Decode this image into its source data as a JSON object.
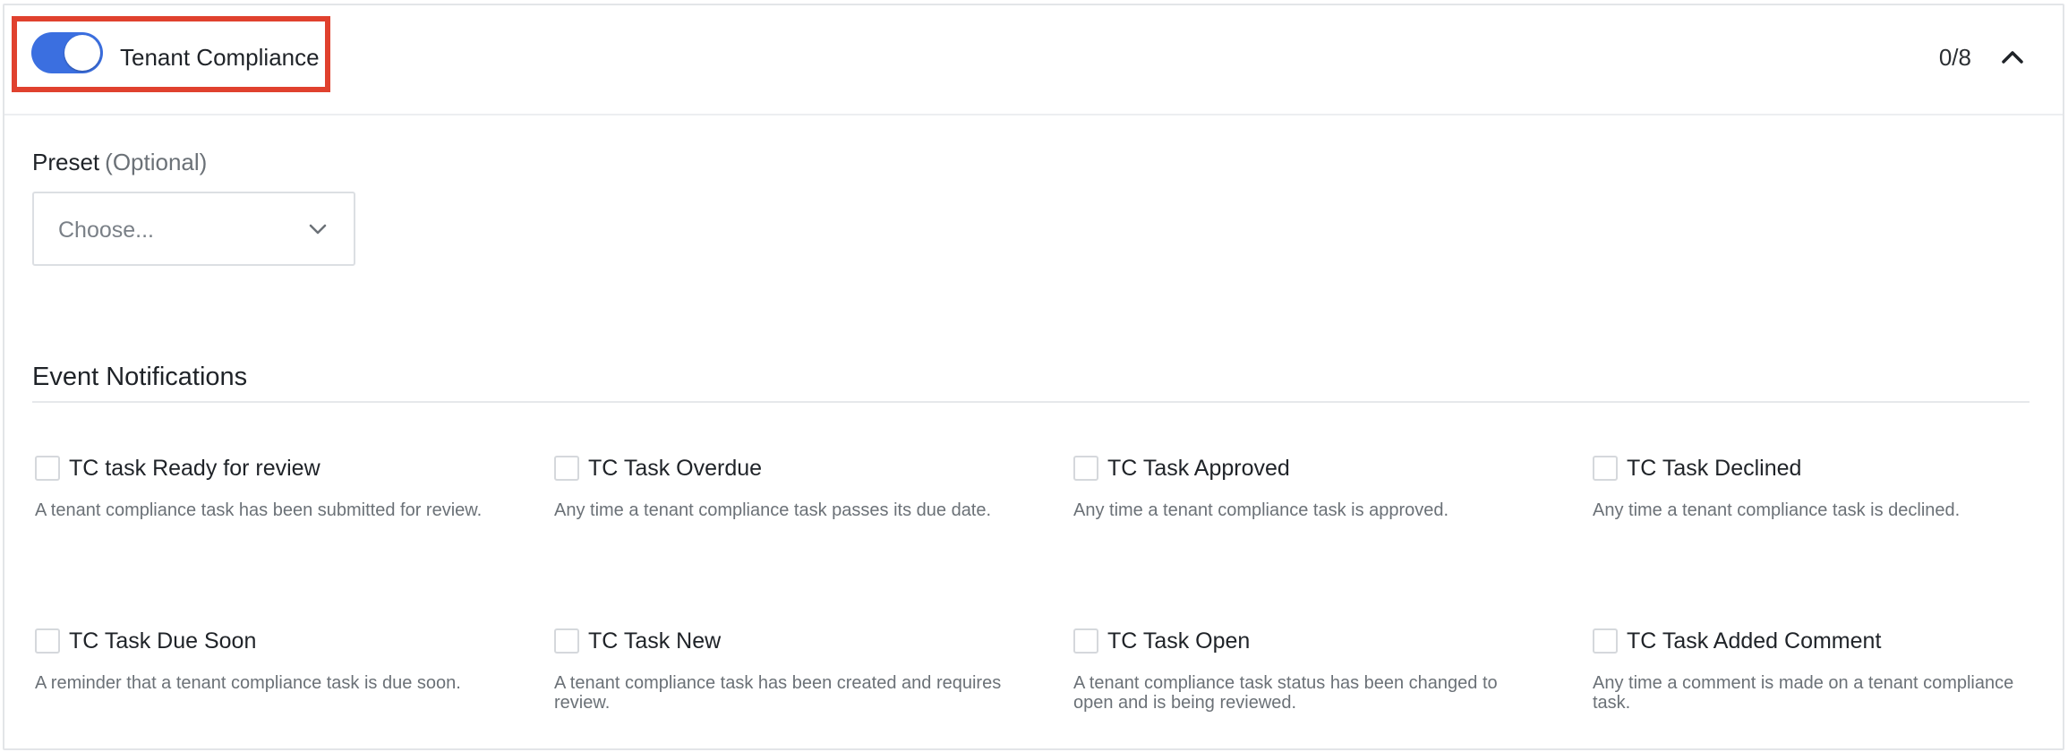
{
  "header": {
    "toggle_on": true,
    "title": "Tenant Compliance",
    "counter": "0/8",
    "highlight_color": "#e0412e",
    "toggle_color": "#3b6fe0"
  },
  "preset": {
    "label": "Preset",
    "optional": "(Optional)",
    "placeholder": "Choose..."
  },
  "events": {
    "title": "Event Notifications",
    "items": [
      {
        "label": "TC task Ready for review",
        "description": "A tenant compliance task has been submitted for review."
      },
      {
        "label": "TC Task Overdue",
        "description": "Any time a tenant compliance task passes its due date."
      },
      {
        "label": "TC Task Approved",
        "description": "Any time a tenant compliance task is approved."
      },
      {
        "label": "TC Task Declined",
        "description": "Any time a tenant compliance task is declined."
      },
      {
        "label": "TC Task Due Soon",
        "description": "A reminder that a tenant compliance task is due soon."
      },
      {
        "label": "TC Task New",
        "description": "A tenant compliance task has been created and requires review."
      },
      {
        "label": "TC Task Open",
        "description": "A tenant compliance task status has been changed to open and is being reviewed."
      },
      {
        "label": "TC Task Added Comment",
        "description": "Any time a comment is made on a tenant compliance task."
      }
    ]
  }
}
